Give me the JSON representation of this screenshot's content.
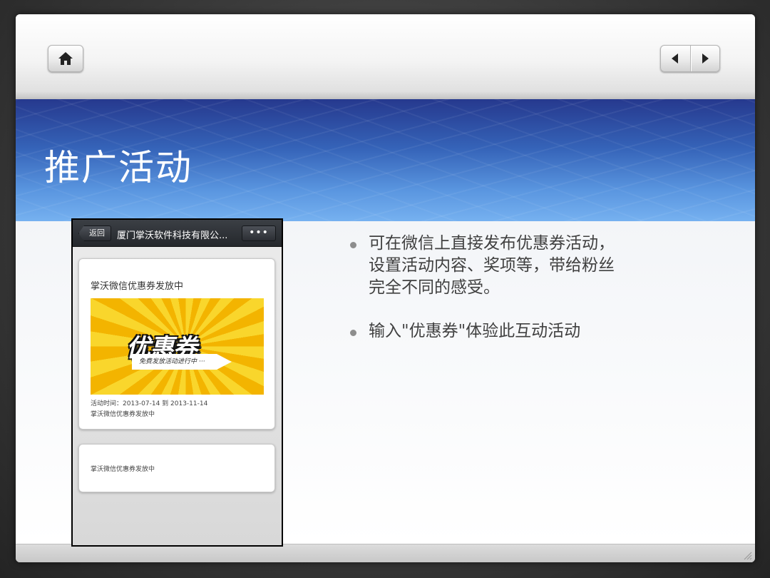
{
  "slide": {
    "title": "推广活动"
  },
  "toolbar": {
    "home_icon": "home-icon",
    "prev_icon": "triangle-left-icon",
    "next_icon": "triangle-right-icon"
  },
  "phone": {
    "header": {
      "back_label": "返回",
      "title": "厦门掌沃软件科技有限公...",
      "more_label": "•••"
    },
    "card1": {
      "title": "掌沃微信优惠券发放中",
      "coupon_word": "优惠券",
      "coupon_tagline": "免费发放活动进行中 ···",
      "meta_time": "活动时间：2013-07-14  到  2013-11-14",
      "meta_desc": "掌沃微信优惠券发放中"
    },
    "card2": {
      "text": "掌沃微信优惠券发放中"
    }
  },
  "bullets": [
    {
      "lines": [
        "可在微信上直接发布优惠券活动，",
        "设置活动内容、奖项等，带给粉丝",
        "完全不同的感受。"
      ]
    },
    {
      "lines": [
        "输入\"优惠券\"体验此互动活动"
      ]
    }
  ],
  "colors": {
    "banner_top": "#26398e",
    "banner_bottom": "#76b1f0",
    "bullet_text": "#404040"
  }
}
